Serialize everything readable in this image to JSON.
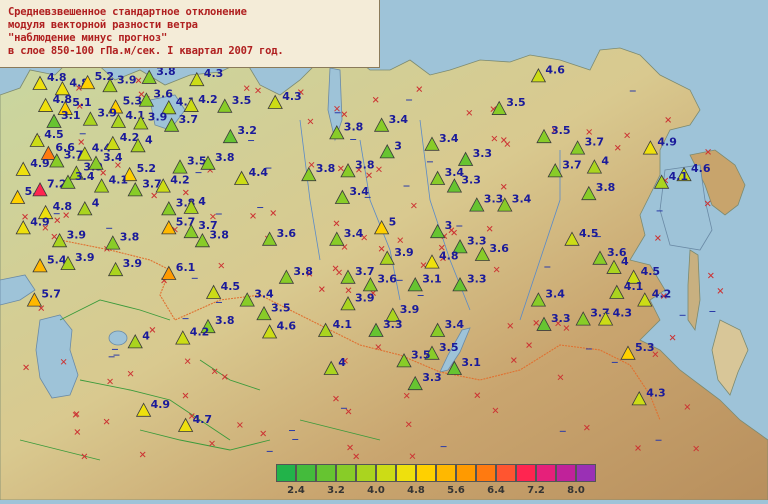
{
  "title_lines": [
    "Средневзвешенное стандартное отклонение",
    "модуля векторной разности ветра",
    "\"наблюдение минус прогноз\"",
    "в слое 850-100 гПа.м/сек. I квартал 2007 год."
  ],
  "legend": {
    "colors": [
      "#22b34a",
      "#44bb3c",
      "#66c431",
      "#88cc28",
      "#aad41f",
      "#ccdc16",
      "#eee00d",
      "#ffd000",
      "#ffb800",
      "#ff9a00",
      "#ff7a10",
      "#ff5530",
      "#ff2550",
      "#e6207a",
      "#c0229a",
      "#9a30b5"
    ],
    "labels": [
      "2.4",
      "3.2",
      "4.0",
      "4.8",
      "5.6",
      "6.4",
      "7.2",
      "8.0"
    ]
  },
  "stations": [
    {
      "v": "4.8",
      "lon": 25.0,
      "lat": 67.5
    },
    {
      "v": "4.8",
      "lon": 29.0,
      "lat": 66.8
    },
    {
      "v": "5.2",
      "lon": 33.5,
      "lat": 67.6
    },
    {
      "v": "3.9",
      "lon": 37.5,
      "lat": 67.2
    },
    {
      "v": "3.8",
      "lon": 44.5,
      "lat": 68.3
    },
    {
      "v": "4.3",
      "lon": 53.0,
      "lat": 68.0
    },
    {
      "v": "4.8",
      "lon": 26.0,
      "lat": 64.6
    },
    {
      "v": "5.1",
      "lon": 29.5,
      "lat": 64.2
    },
    {
      "v": "5.3",
      "lon": 38.5,
      "lat": 64.4
    },
    {
      "v": "3.6",
      "lon": 44.0,
      "lat": 65.3
    },
    {
      "v": "4.1",
      "lon": 48.0,
      "lat": 64.3
    },
    {
      "v": "4.2",
      "lon": 52.0,
      "lat": 64.6
    },
    {
      "v": "3.5",
      "lon": 58.0,
      "lat": 64.5
    },
    {
      "v": "4.3",
      "lon": 67.0,
      "lat": 65.0
    },
    {
      "v": "3.1",
      "lon": 27.5,
      "lat": 62.5
    },
    {
      "v": "3.9",
      "lon": 34.0,
      "lat": 62.8
    },
    {
      "v": "4.1",
      "lon": 39.0,
      "lat": 62.5
    },
    {
      "v": "3.9",
      "lon": 43.0,
      "lat": 62.3
    },
    {
      "v": "3.7",
      "lon": 48.5,
      "lat": 62.0
    },
    {
      "v": "4.5",
      "lon": 24.5,
      "lat": 60.0
    },
    {
      "v": "6.6",
      "lon": 26.5,
      "lat": 58.3
    },
    {
      "v": "4.4",
      "lon": 33.0,
      "lat": 58.2
    },
    {
      "v": "4.2",
      "lon": 38.0,
      "lat": 59.6
    },
    {
      "v": "4",
      "lon": 42.5,
      "lat": 59.3
    },
    {
      "v": "3.2",
      "lon": 59.0,
      "lat": 60.5
    },
    {
      "v": "3.8",
      "lon": 78.0,
      "lat": 61.0
    },
    {
      "v": "4.9",
      "lon": 22.0,
      "lat": 56.2
    },
    {
      "v": "3.7",
      "lon": 28.0,
      "lat": 57.3
    },
    {
      "v": "3.9",
      "lon": 31.5,
      "lat": 55.7
    },
    {
      "v": "3.4",
      "lon": 35.0,
      "lat": 57.0
    },
    {
      "v": "5.2",
      "lon": 41.0,
      "lat": 55.5
    },
    {
      "v": "3.5",
      "lon": 50.0,
      "lat": 56.5
    },
    {
      "v": "3.8",
      "lon": 55.0,
      "lat": 57.0
    },
    {
      "v": "4.4",
      "lon": 61.0,
      "lat": 55.0
    },
    {
      "v": "5.3",
      "lon": 21.0,
      "lat": 52.5
    },
    {
      "v": "7.2",
      "lon": 25.0,
      "lat": 53.5
    },
    {
      "v": "3.4",
      "lon": 30.0,
      "lat": 54.5
    },
    {
      "v": "4.1",
      "lon": 36.0,
      "lat": 54.0
    },
    {
      "v": "3.7",
      "lon": 42.0,
      "lat": 53.5
    },
    {
      "v": "4.2",
      "lon": 47.0,
      "lat": 54.0
    },
    {
      "v": "3.8",
      "lon": 73.0,
      "lat": 55.5
    },
    {
      "v": "4.8",
      "lon": 26.0,
      "lat": 50.5
    },
    {
      "v": "4",
      "lon": 33.0,
      "lat": 51.0
    },
    {
      "v": "3.8",
      "lon": 48.0,
      "lat": 51.0
    },
    {
      "v": "4",
      "lon": 52.0,
      "lat": 51.2
    },
    {
      "v": "4.9",
      "lon": 22.0,
      "lat": 48.5
    },
    {
      "v": "5.7",
      "lon": 48.0,
      "lat": 48.5
    },
    {
      "v": "3.7",
      "lon": 52.0,
      "lat": 48.0
    },
    {
      "v": "3.9",
      "lon": 28.5,
      "lat": 46.8
    },
    {
      "v": "3.8",
      "lon": 38.0,
      "lat": 46.5
    },
    {
      "v": "3.8",
      "lon": 54.0,
      "lat": 46.8
    },
    {
      "v": "3.6",
      "lon": 66.0,
      "lat": 47.0
    },
    {
      "v": "5.4",
      "lon": 25.0,
      "lat": 43.5
    },
    {
      "v": "3.9",
      "lon": 30.0,
      "lat": 43.8
    },
    {
      "v": "3.9",
      "lon": 38.5,
      "lat": 43.0
    },
    {
      "v": "6.1",
      "lon": 48.0,
      "lat": 42.5
    },
    {
      "v": "5.7",
      "lon": 24.0,
      "lat": 39.0
    },
    {
      "v": "4.5",
      "lon": 56.0,
      "lat": 40.0
    },
    {
      "v": "3.4",
      "lon": 62.0,
      "lat": 39.0
    },
    {
      "v": "3.8",
      "lon": 69.0,
      "lat": 42.0
    },
    {
      "v": "3.5",
      "lon": 65.0,
      "lat": 37.2
    },
    {
      "v": "4.6",
      "lon": 66.0,
      "lat": 34.8
    },
    {
      "v": "3.8",
      "lon": 55.0,
      "lat": 35.5
    },
    {
      "v": "4",
      "lon": 42.0,
      "lat": 33.5
    },
    {
      "v": "4.2",
      "lon": 50.5,
      "lat": 34.0
    },
    {
      "v": "3.4",
      "lon": 79.0,
      "lat": 52.5
    },
    {
      "v": "3.4",
      "lon": 78.0,
      "lat": 47.0
    },
    {
      "v": "3.8",
      "lon": 80.0,
      "lat": 56.0
    },
    {
      "v": "3",
      "lon": 87.0,
      "lat": 58.5
    },
    {
      "v": "3.4",
      "lon": 96.0,
      "lat": 55.0
    },
    {
      "v": "3.3",
      "lon": 99.0,
      "lat": 54.0
    },
    {
      "v": "5",
      "lon": 86.0,
      "lat": 48.5
    },
    {
      "v": "3.3",
      "lon": 103.0,
      "lat": 51.5
    },
    {
      "v": "3.4",
      "lon": 108.0,
      "lat": 51.5
    },
    {
      "v": "3",
      "lon": 96.0,
      "lat": 48.0
    },
    {
      "v": "3.3",
      "lon": 100.0,
      "lat": 46.0
    },
    {
      "v": "3.6",
      "lon": 104.0,
      "lat": 45.0
    },
    {
      "v": "3.9",
      "lon": 87.0,
      "lat": 44.5
    },
    {
      "v": "4.8",
      "lon": 95.0,
      "lat": 44.0
    },
    {
      "v": "3.7",
      "lon": 80.0,
      "lat": 42.0
    },
    {
      "v": "3.6",
      "lon": 84.0,
      "lat": 41.0
    },
    {
      "v": "3.1",
      "lon": 92.0,
      "lat": 41.0
    },
    {
      "v": "3.3",
      "lon": 100.0,
      "lat": 41.0
    },
    {
      "v": "3.9",
      "lon": 80.0,
      "lat": 38.5
    },
    {
      "v": "3.9",
      "lon": 88.0,
      "lat": 37.0
    },
    {
      "v": "3.3",
      "lon": 85.0,
      "lat": 35.0
    },
    {
      "v": "4.1",
      "lon": 76.0,
      "lat": 35.0
    },
    {
      "v": "3.4",
      "lon": 96.0,
      "lat": 35.0
    },
    {
      "v": "3.5",
      "lon": 95.0,
      "lat": 32.0
    },
    {
      "v": "3.5",
      "lon": 90.0,
      "lat": 31.0
    },
    {
      "v": "3.1",
      "lon": 99.0,
      "lat": 30.0
    },
    {
      "v": "3.3",
      "lon": 92.0,
      "lat": 28.0
    },
    {
      "v": "4",
      "lon": 77.0,
      "lat": 30.0
    },
    {
      "v": "3.4",
      "lon": 86.0,
      "lat": 62.0
    },
    {
      "v": "3.4",
      "lon": 95.0,
      "lat": 59.5
    },
    {
      "v": "3.3",
      "lon": 101.0,
      "lat": 57.5
    },
    {
      "v": "3.5",
      "lon": 107.0,
      "lat": 64.2
    },
    {
      "v": "4.6",
      "lon": 114.0,
      "lat": 68.5
    },
    {
      "v": "3.5",
      "lon": 115.0,
      "lat": 60.5
    },
    {
      "v": "3.7",
      "lon": 121.0,
      "lat": 59.0
    },
    {
      "v": "3.7",
      "lon": 117.0,
      "lat": 56.0
    },
    {
      "v": "4",
      "lon": 124.0,
      "lat": 56.5
    },
    {
      "v": "4.9",
      "lon": 134.0,
      "lat": 59.0
    },
    {
      "v": "3.8",
      "lon": 123.0,
      "lat": 53.0
    },
    {
      "v": "4.6",
      "lon": 140.0,
      "lat": 55.5
    },
    {
      "v": "4.1",
      "lon": 136.0,
      "lat": 54.5
    },
    {
      "v": "4.5",
      "lon": 120.0,
      "lat": 47.0
    },
    {
      "v": "3.6",
      "lon": 125.0,
      "lat": 44.5
    },
    {
      "v": "4",
      "lon": 127.5,
      "lat": 43.3
    },
    {
      "v": "4.5",
      "lon": 131.0,
      "lat": 42.0
    },
    {
      "v": "4.1",
      "lon": 128.0,
      "lat": 40.0
    },
    {
      "v": "4.2",
      "lon": 133.0,
      "lat": 39.0
    },
    {
      "v": "3.4",
      "lon": 114.0,
      "lat": 39.0
    },
    {
      "v": "3.3",
      "lon": 115.0,
      "lat": 35.8
    },
    {
      "v": "3.7",
      "lon": 122.0,
      "lat": 36.5
    },
    {
      "v": "4.3",
      "lon": 126.0,
      "lat": 36.5
    },
    {
      "v": "5.3",
      "lon": 130.0,
      "lat": 32.0
    },
    {
      "v": "4.3",
      "lon": 132.0,
      "lat": 26.0
    },
    {
      "v": "4.9",
      "lon": 43.5,
      "lat": 24.5
    },
    {
      "v": "4.7",
      "lon": 51.0,
      "lat": 22.5
    }
  ]
}
